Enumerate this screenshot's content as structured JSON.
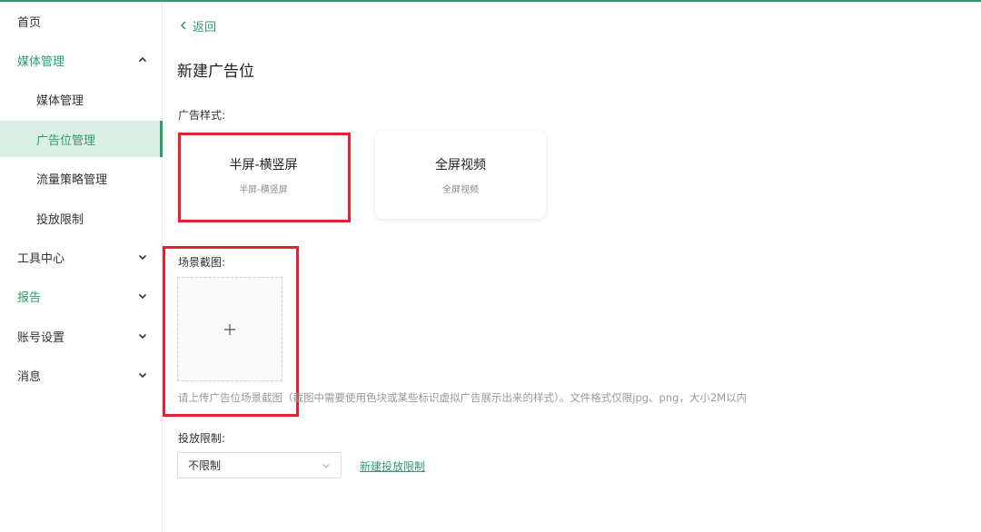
{
  "sidebar": {
    "items": [
      {
        "label": "首页"
      },
      {
        "label": "媒体管理"
      },
      {
        "label": "媒体管理"
      },
      {
        "label": "广告位管理"
      },
      {
        "label": "流量策略管理"
      },
      {
        "label": "投放限制"
      },
      {
        "label": "工具中心"
      },
      {
        "label": "报告"
      },
      {
        "label": "账号设置"
      },
      {
        "label": "消息"
      }
    ]
  },
  "header": {
    "back_label": "返回",
    "title": "新建广告位"
  },
  "form": {
    "ad_style_label": "广告样式:",
    "styles": [
      {
        "title": "半屏-横竖屏",
        "subtitle": "半屏-横竖屏"
      },
      {
        "title": "全屏视频",
        "subtitle": "全屏视频"
      }
    ],
    "screenshot_label": "场景截图:",
    "upload_hint": "请上传广告位场景截图（截图中需要使用色块或某些标识虚拟广告展示出来的样式）。文件格式仅限jpg、png，大小2M以内",
    "limit_label": "投放限制:",
    "limit_value": "不限制",
    "new_limit_link": "新建投放限制"
  },
  "colors": {
    "accent": "#2e9b6b",
    "active_bg": "#dcefe5",
    "highlight": "#e0242f"
  },
  "icons": {
    "back": "chevron-left-icon",
    "expand": "chevron-down-icon",
    "collapse": "chevron-up-icon",
    "upload": "plus-icon",
    "select": "chevron-down-icon"
  }
}
